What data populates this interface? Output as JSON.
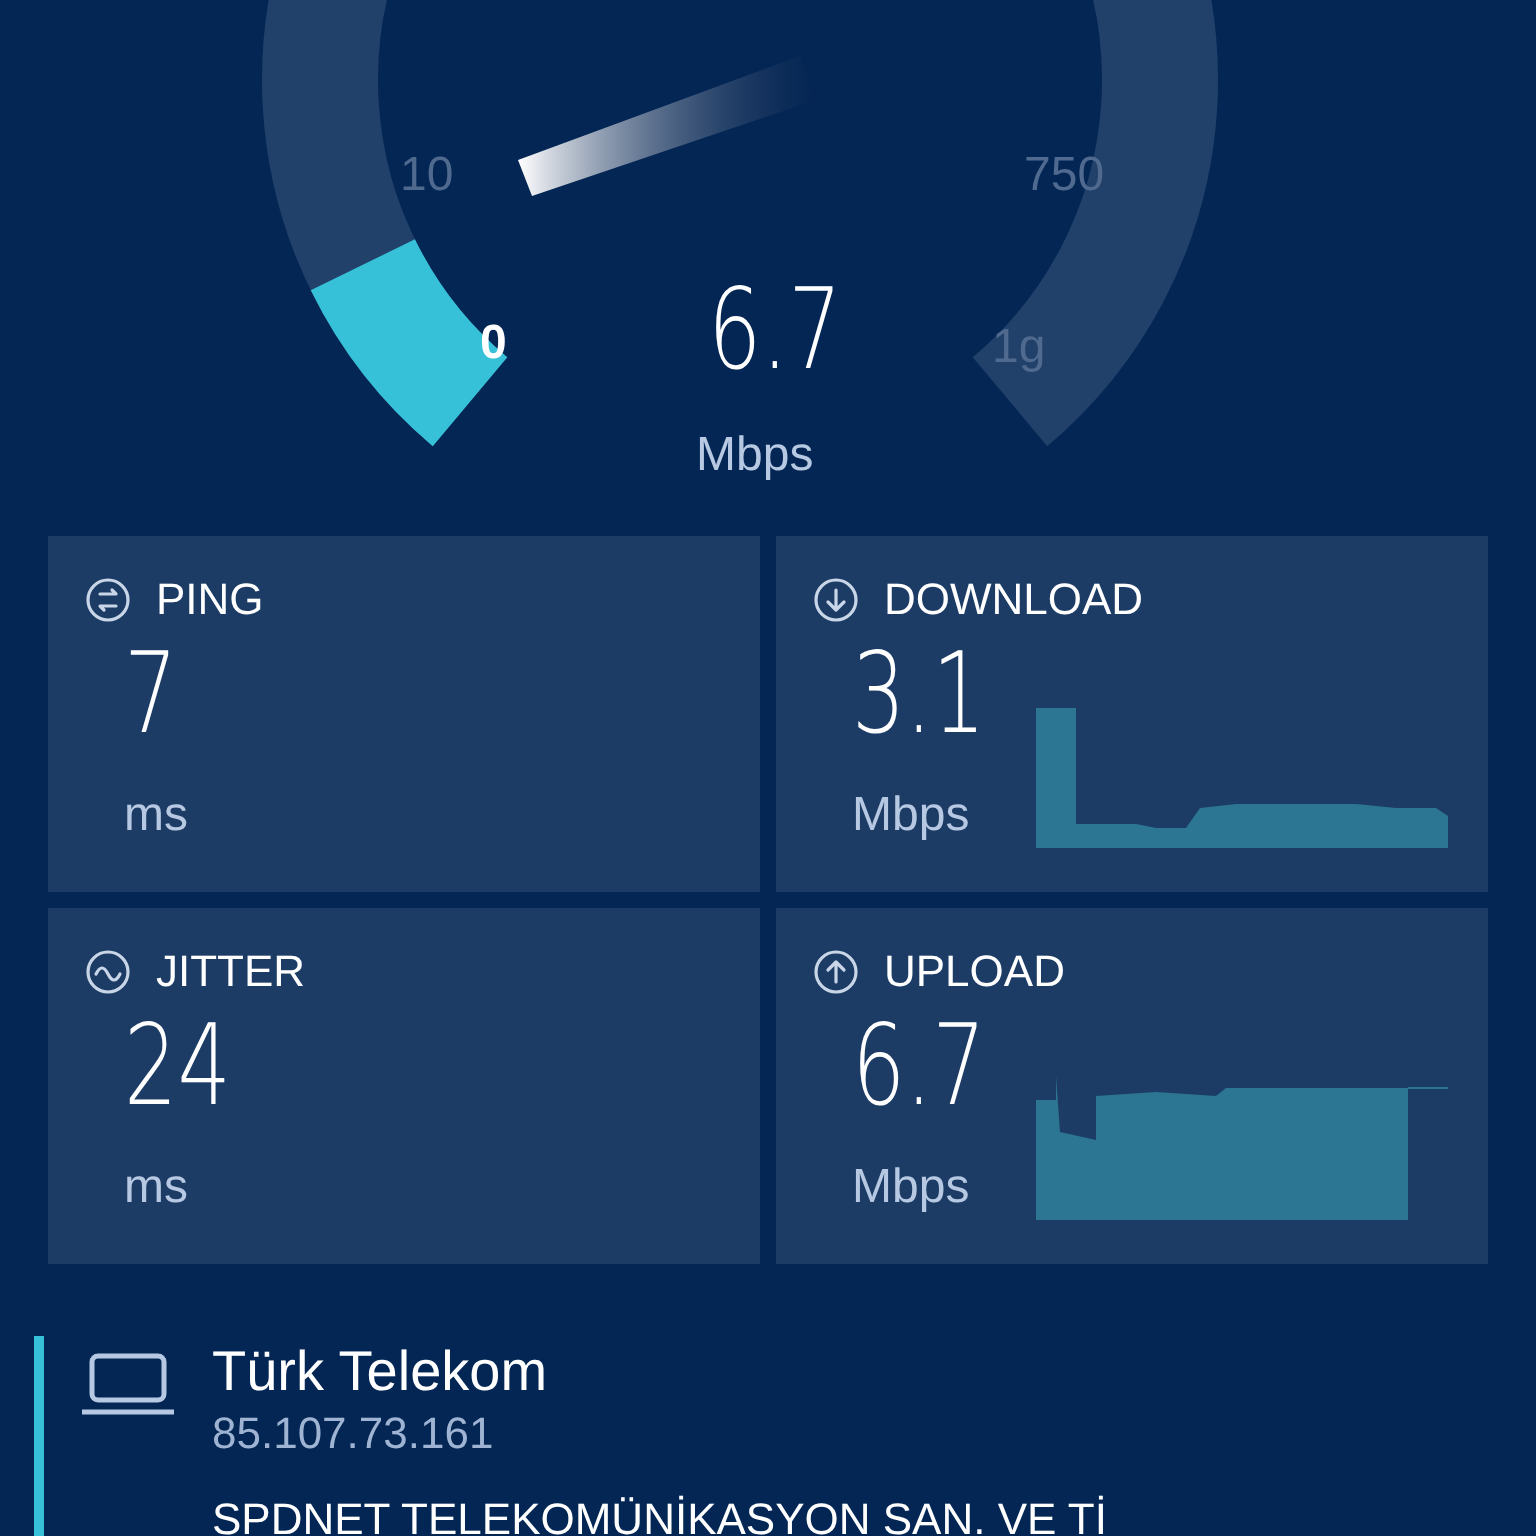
{
  "gauge": {
    "ticks": [
      {
        "label": "10",
        "kind": "dim"
      },
      {
        "label": "750",
        "kind": "dim"
      },
      {
        "label": "0",
        "kind": "bright"
      },
      {
        "label": "1g",
        "kind": "dim"
      }
    ],
    "value": "6.7",
    "unit": "Mbps"
  },
  "metrics": [
    {
      "kind": "ping",
      "label": "PING",
      "value": "7",
      "unit": "ms"
    },
    {
      "kind": "download",
      "label": "DOWNLOAD",
      "value": "3.1",
      "unit": "Mbps"
    },
    {
      "kind": "jitter",
      "label": "JITTER",
      "value": "24",
      "unit": "ms"
    },
    {
      "kind": "upload",
      "label": "UPLOAD",
      "value": "6.7",
      "unit": "Mbps"
    }
  ],
  "provider": {
    "name": "Türk Telekom",
    "ip": "85.107.73.161",
    "server": "SPDNET TELEKOMÜNİKASYON SAN. VE Tİ"
  }
}
